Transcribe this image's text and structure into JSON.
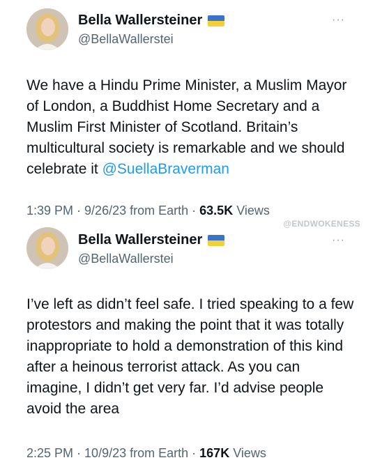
{
  "watermark": "@ENDWOKENESS",
  "tweets": [
    {
      "display_name": "Bella Wallersteiner",
      "handle": "@BellaWallerstei",
      "more": "···",
      "text": "We have a Hindu Prime Minister, a Muslim Mayor of London, a Buddhist Home Secretary and a Muslim First Minister of Scotland. Britain’s multicultural society is remarkable and we should celebrate it ",
      "mention": "@SuellaBraverman",
      "time": "1:39 PM",
      "date": "9/26/23",
      "source": "from Earth",
      "views_count": "63.5K",
      "views_label": "Views"
    },
    {
      "display_name": "Bella Wallersteiner",
      "handle": "@BellaWallerstei",
      "more": "···",
      "text": "I’ve left as didn’t feel safe. I tried speaking to a few protestors and making the point that it was totally inappropriate to hold a demonstration of this kind after a heinous terrorist attack. As you can imagine, I didn’t get very far. I’d advise people avoid the area",
      "time": "2:25 PM",
      "date": "10/9/23",
      "source": "from Earth",
      "views_count": "167K",
      "views_label": "Views"
    }
  ],
  "colors": {
    "text": "#0f1419",
    "secondary": "#536471",
    "link": "#1d9bf0",
    "flag_blue": "#3b73c5",
    "flag_yellow": "#f2d137"
  }
}
